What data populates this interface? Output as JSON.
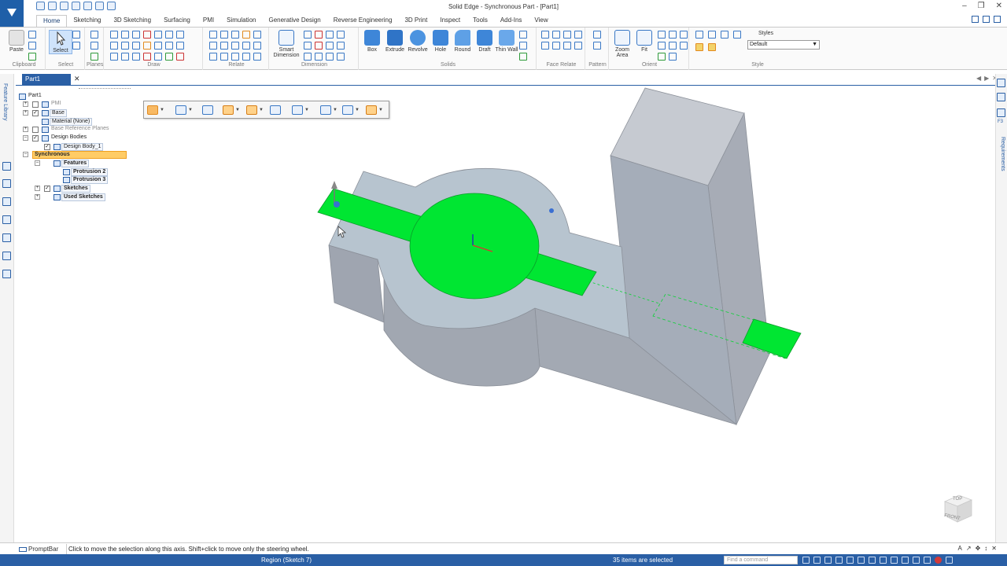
{
  "title_bar": {
    "title": "Solid Edge - Synchronous Part - [Part1]"
  },
  "ribbon_tabs": [
    "Home",
    "Sketching",
    "3D Sketching",
    "Surfacing",
    "PMI",
    "Simulation",
    "Generative Design",
    "Reverse Engineering",
    "3D Print",
    "Inspect",
    "Tools",
    "Add-Ins",
    "View"
  ],
  "active_tab": "Home",
  "ribbon": {
    "groups": {
      "clipboard": "Clipboard",
      "select": "Select",
      "planes": "Planes",
      "draw": "Draw",
      "relate": "Relate",
      "dimension": "Dimension",
      "solids": "Solids",
      "face_relate": "Face Relate",
      "pattern": "Pattern",
      "orient": "Orient",
      "style": "Style"
    },
    "buttons": {
      "paste": "Paste",
      "select": "Select",
      "smart_dimension": "Smart Dimension",
      "box": "Box",
      "extrude": "Extrude",
      "revolve": "Revolve",
      "hole": "Hole",
      "round": "Round",
      "draft": "Draft",
      "thin_wall": "Thin Wall",
      "zoom_area": "Zoom Area",
      "fit": "Fit"
    },
    "styles_label": "Styles",
    "style_value": "Default"
  },
  "document_tab": {
    "label": "Part1"
  },
  "side_panels": {
    "feature_library": "Feature Library",
    "requirements": "Requirements",
    "f3_label": "F3"
  },
  "tree": {
    "root": "Part1",
    "pmi": "PMI",
    "base": "Base",
    "material": "Material (None)",
    "base_reference_planes": "Base Reference Planes",
    "design_bodies": "Design Bodies",
    "design_body_1": "Design Body_1",
    "synchronous": "Synchronous",
    "features": "Features",
    "protrusion_2": "Protrusion 2",
    "protrusion_3": "Protrusion 3",
    "sketches": "Sketches",
    "used_sketches": "Used Sketches"
  },
  "view_cube": {
    "top": "TOP",
    "front": "FRONT"
  },
  "prompt_bar": {
    "label": "PromptBar",
    "message": "Click to move the selection along this axis.  Shift+click to move only the steering wheel."
  },
  "status_bar": {
    "left": "Region (Sketch 7)",
    "middle": "35 items are selected",
    "command_finder_placeholder": "Find a command"
  },
  "colors": {
    "brand": "#2a5fa5",
    "selection_green": "#00e632",
    "model_face": "#a9b1bd",
    "model_top": "#b3c3cf",
    "tree_highlight": "#ffcc66"
  }
}
